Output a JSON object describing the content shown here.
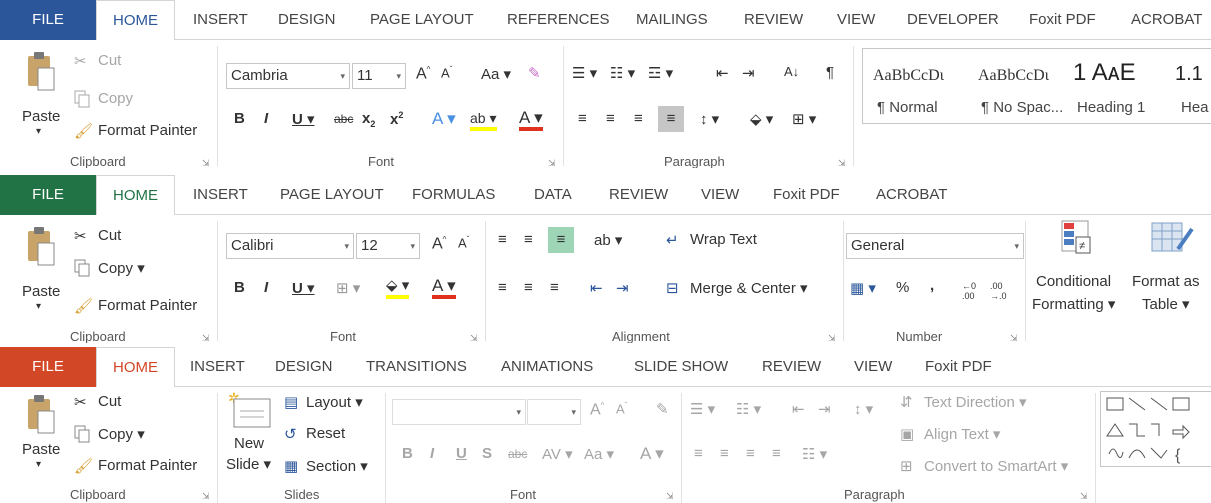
{
  "word": {
    "accent": "#2b579a",
    "tabs": [
      "FILE",
      "HOME",
      "INSERT",
      "DESIGN",
      "PAGE LAYOUT",
      "REFERENCES",
      "MAILINGS",
      "REVIEW",
      "VIEW",
      "DEVELOPER",
      "Foxit PDF",
      "ACROBAT"
    ],
    "clipboard": {
      "paste": "Paste",
      "cut": "Cut",
      "copy": "Copy",
      "format_painter": "Format Painter",
      "label": "Clipboard"
    },
    "font": {
      "name": "Cambria",
      "size": "11",
      "label": "Font"
    },
    "paragraph": {
      "label": "Paragraph"
    },
    "styles": [
      {
        "sample": "AaBbCcDι",
        "name": "¶ Normal"
      },
      {
        "sample": "AaBbCcDι",
        "name": "¶ No Spac..."
      },
      {
        "sample": "1  AᴀE",
        "name": "Heading 1"
      },
      {
        "sample": "1.1",
        "name": "Hea"
      }
    ]
  },
  "excel": {
    "accent": "#217346",
    "tabs": [
      "FILE",
      "HOME",
      "INSERT",
      "PAGE LAYOUT",
      "FORMULAS",
      "DATA",
      "REVIEW",
      "VIEW",
      "Foxit PDF",
      "ACROBAT"
    ],
    "clipboard": {
      "paste": "Paste",
      "cut": "Cut",
      "copy": "Copy",
      "format_painter": "Format Painter",
      "label": "Clipboard"
    },
    "font": {
      "name": "Calibri",
      "size": "12",
      "label": "Font"
    },
    "alignment": {
      "wrap_text": "Wrap Text",
      "merge_center": "Merge & Center",
      "label": "Alignment"
    },
    "number": {
      "format": "General",
      "percent": "%",
      "comma": ",",
      "label": "Number"
    },
    "styles": {
      "conditional_line1": "Conditional",
      "conditional_line2": "Formatting",
      "format_as_line1": "Format as",
      "format_as_line2": "Table"
    }
  },
  "powerpoint": {
    "accent": "#d24726",
    "tabs": [
      "FILE",
      "HOME",
      "INSERT",
      "DESIGN",
      "TRANSITIONS",
      "ANIMATIONS",
      "SLIDE SHOW",
      "REVIEW",
      "VIEW",
      "Foxit PDF"
    ],
    "clipboard": {
      "paste": "Paste",
      "cut": "Cut",
      "copy": "Copy",
      "format_painter": "Format Painter",
      "label": "Clipboard"
    },
    "slides": {
      "new_line1": "New",
      "new_line2": "Slide",
      "layout": "Layout",
      "reset": "Reset",
      "section": "Section",
      "label": "Slides"
    },
    "font": {
      "label": "Font"
    },
    "paragraph": {
      "text_direction": "Text Direction",
      "align_text": "Align Text",
      "convert_smartart": "Convert to SmartArt",
      "label": "Paragraph"
    }
  }
}
